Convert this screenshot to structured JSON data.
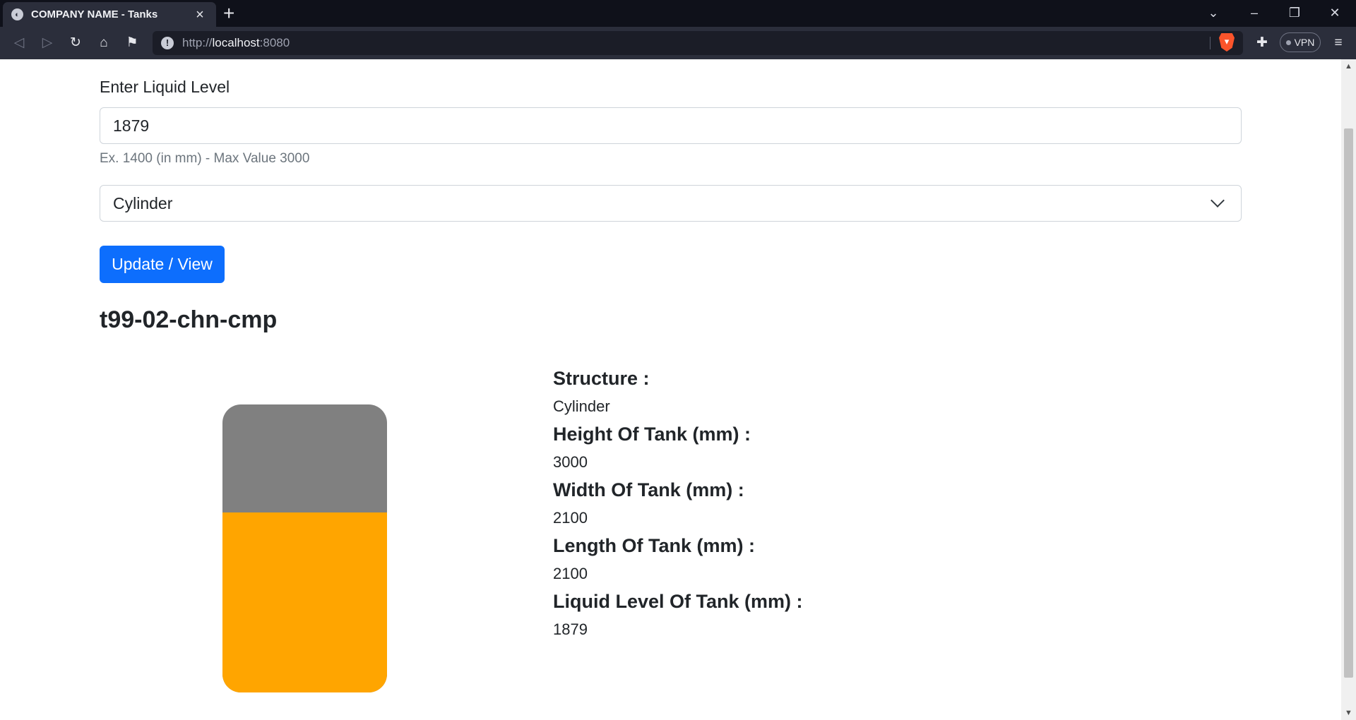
{
  "browser": {
    "tab_title": "COMPANY NAME - Tanks",
    "url_scheme": "http://",
    "url_host": "localhost",
    "url_port": ":8080",
    "vpn_label": "VPN"
  },
  "form": {
    "liquid_label": "Enter Liquid Level",
    "liquid_value": "1879",
    "liquid_help": "Ex. 1400 (in mm) - Max Value 3000",
    "structure_selected": "Cylinder",
    "submit_label": "Update / View"
  },
  "tank": {
    "name": "t99-02-chn-cmp",
    "fill_fraction": 0.626,
    "fill_color": "#ffa500",
    "empty_color": "#808080"
  },
  "details": [
    {
      "label": "Structure :",
      "value": "Cylinder"
    },
    {
      "label": "Height Of Tank (mm) :",
      "value": "3000"
    },
    {
      "label": "Width Of Tank (mm) :",
      "value": "2100"
    },
    {
      "label": "Length Of Tank (mm) :",
      "value": "2100"
    },
    {
      "label": "Liquid Level Of Tank (mm) :",
      "value": "1879"
    }
  ],
  "colors": {
    "primary_button": "#0d6efd",
    "chrome_dark": "#0f111a",
    "toolbar": "#2b2e3b"
  }
}
